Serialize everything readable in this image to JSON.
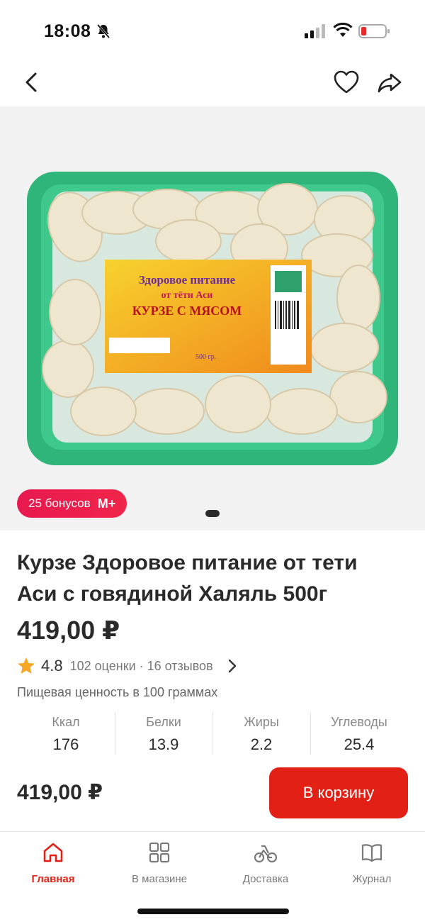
{
  "status_bar": {
    "time": "18:08"
  },
  "product": {
    "title": "Курзе Здоровое питание от тети Аси с говядиной Халяль 500г",
    "price": "419,00 ₽",
    "image_label": {
      "line1": "Здоровое питание",
      "line2": "от тёти Аси",
      "line3": "КУРЗЕ С МЯСОМ",
      "weight": "500 гр."
    }
  },
  "bonus": {
    "text": "25 бонусов",
    "logo": "M+"
  },
  "rating": {
    "value": "4.8",
    "meta": "102 оценки · 16 отзывов"
  },
  "nutrition": {
    "title": "Пищевая ценность в 100 граммах",
    "items": [
      {
        "label": "Ккал",
        "value": "176"
      },
      {
        "label": "Белки",
        "value": "13.9"
      },
      {
        "label": "Жиры",
        "value": "2.2"
      },
      {
        "label": "Углеводы",
        "value": "25.4"
      }
    ]
  },
  "cart": {
    "price": "419,00 ₽",
    "button_label": "В корзину"
  },
  "tabs": [
    {
      "label": "Главная",
      "icon": "home-icon"
    },
    {
      "label": "В магазине",
      "icon": "grid-icon"
    },
    {
      "label": "Доставка",
      "icon": "bike-icon"
    },
    {
      "label": "Журнал",
      "icon": "book-icon"
    }
  ],
  "colors": {
    "accent": "#e32016",
    "bonus": "#e8194f",
    "star": "#f5a623",
    "tray": "#2fb57a"
  }
}
